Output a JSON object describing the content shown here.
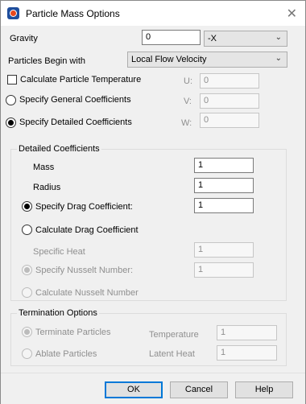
{
  "window": {
    "title": "Particle Mass Options",
    "icon": "app-logo-icon",
    "close": "✕"
  },
  "gravity": {
    "label": "Gravity",
    "value": "0",
    "direction": "-X"
  },
  "particles_begin": {
    "label": "Particles Begin with",
    "value": "Local Flow Velocity"
  },
  "options": {
    "calc_temp": "Calculate Particle Temperature",
    "general_coeffs": "Specify General Coefficients",
    "detailed_coeffs": "Specify Detailed Coefficients"
  },
  "velocity": {
    "u_label": "U:",
    "u_value": "0",
    "v_label": "V:",
    "v_value": "0",
    "w_label": "W:",
    "w_value": "0"
  },
  "detailed": {
    "title": "Detailed Coefficients",
    "mass_label": "Mass",
    "mass_value": "1",
    "radius_label": "Radius",
    "radius_value": "1",
    "specify_drag_label": "Specify Drag Coefficient:",
    "specify_drag_value": "1",
    "calc_drag_label": "Calculate Drag Coefficient",
    "specific_heat_label": "Specific Heat",
    "specific_heat_value": "1",
    "specify_nusselt_label": "Specify Nusselt Number:",
    "specify_nusselt_value": "1",
    "calc_nusselt_label": "Calculate Nusselt Number"
  },
  "termination": {
    "title": "Termination Options",
    "terminate_label": "Terminate Particles",
    "ablate_label": "Ablate Particles",
    "temperature_label": "Temperature",
    "temperature_value": "1",
    "latent_heat_label": "Latent Heat",
    "latent_heat_value": "1"
  },
  "buttons": {
    "ok": "OK",
    "cancel": "Cancel",
    "help": "Help"
  }
}
